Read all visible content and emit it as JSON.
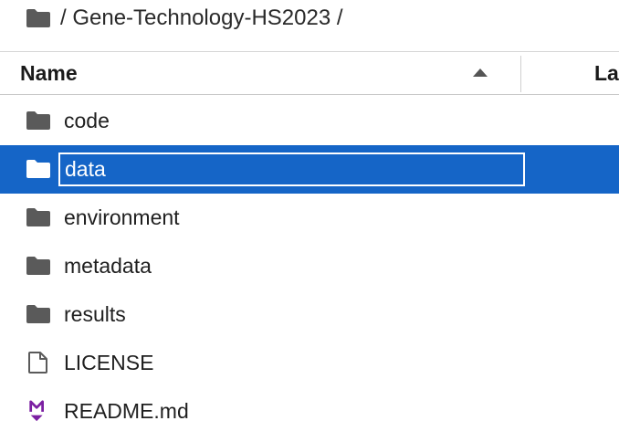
{
  "breadcrumb": {
    "home_icon": "folder-icon",
    "path_text": "/ Gene-Technology-HS2023 /"
  },
  "header": {
    "name_label": "Name",
    "sort_direction": "ascending",
    "modified_label": "Last Modified"
  },
  "colors": {
    "selection": "#1565c7",
    "folder_icon": "#5a5a5a",
    "markdown_icon": "#7b1fa2"
  },
  "files": [
    {
      "name": "code",
      "type": "folder",
      "icon": "folder-icon"
    },
    {
      "name": "data",
      "type": "folder",
      "icon": "folder-icon",
      "selected": true,
      "renaming": true
    },
    {
      "name": "environment",
      "type": "folder",
      "icon": "folder-icon"
    },
    {
      "name": "metadata",
      "type": "folder",
      "icon": "folder-icon"
    },
    {
      "name": "results",
      "type": "folder",
      "icon": "folder-icon"
    },
    {
      "name": "LICENSE",
      "type": "file",
      "icon": "file-icon"
    },
    {
      "name": "README.md",
      "type": "markdown",
      "icon": "markdown-icon"
    }
  ]
}
